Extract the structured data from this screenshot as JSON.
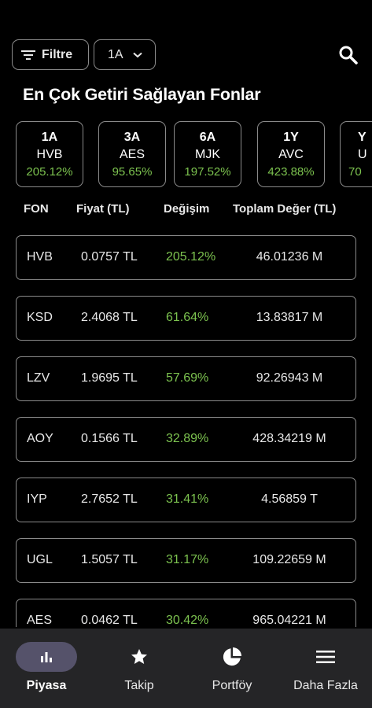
{
  "filters": {
    "filter_label": "Filtre",
    "period_label": "1A"
  },
  "section_title": "En Çok Getiri Sağlayan Fonlar",
  "top_cards": [
    {
      "period": "1A",
      "code": "HVB",
      "return": "205.12%"
    },
    {
      "period": "3A",
      "code": "AES",
      "return": "95.65%"
    },
    {
      "period": "6A",
      "code": "MJK",
      "return": "197.52%"
    },
    {
      "period": "1Y",
      "code": "AVC",
      "return": "423.88%"
    },
    {
      "period": "Y",
      "code": "U",
      "return": "70"
    }
  ],
  "table": {
    "headers": {
      "code": "FON",
      "price": "Fiyat (TL)",
      "change": "Değişim",
      "total": "Toplam Değer (TL)"
    },
    "rows": [
      {
        "code": "HVB",
        "price": "0.0757 TL",
        "change": "205.12%",
        "total": "46.01236 M"
      },
      {
        "code": "KSD",
        "price": "2.4068 TL",
        "change": "61.64%",
        "total": "13.83817 M"
      },
      {
        "code": "LZV",
        "price": "1.9695 TL",
        "change": "57.69%",
        "total": "92.26943 M"
      },
      {
        "code": "AOY",
        "price": "0.1566 TL",
        "change": "32.89%",
        "total": "428.34219 M"
      },
      {
        "code": "IYP",
        "price": "2.7652 TL",
        "change": "31.41%",
        "total": "4.56859 T"
      },
      {
        "code": "UGL",
        "price": "1.5057 TL",
        "change": "31.17%",
        "total": "109.22659 M"
      },
      {
        "code": "AES",
        "price": "0.0462 TL",
        "change": "30.42%",
        "total": "965.04221 M"
      }
    ]
  },
  "bottom_nav": [
    {
      "label": "Piyasa",
      "icon": "bar-chart-icon",
      "active": true
    },
    {
      "label": "Takip",
      "icon": "star-icon",
      "active": false
    },
    {
      "label": "Portföy",
      "icon": "pie-chart-icon",
      "active": false
    },
    {
      "label": "Daha Fazla",
      "icon": "menu-icon",
      "active": false
    }
  ],
  "colors": {
    "positive": "#7cc24f",
    "nav_active_bg": "#55526a",
    "nav_bg": "#252527"
  }
}
